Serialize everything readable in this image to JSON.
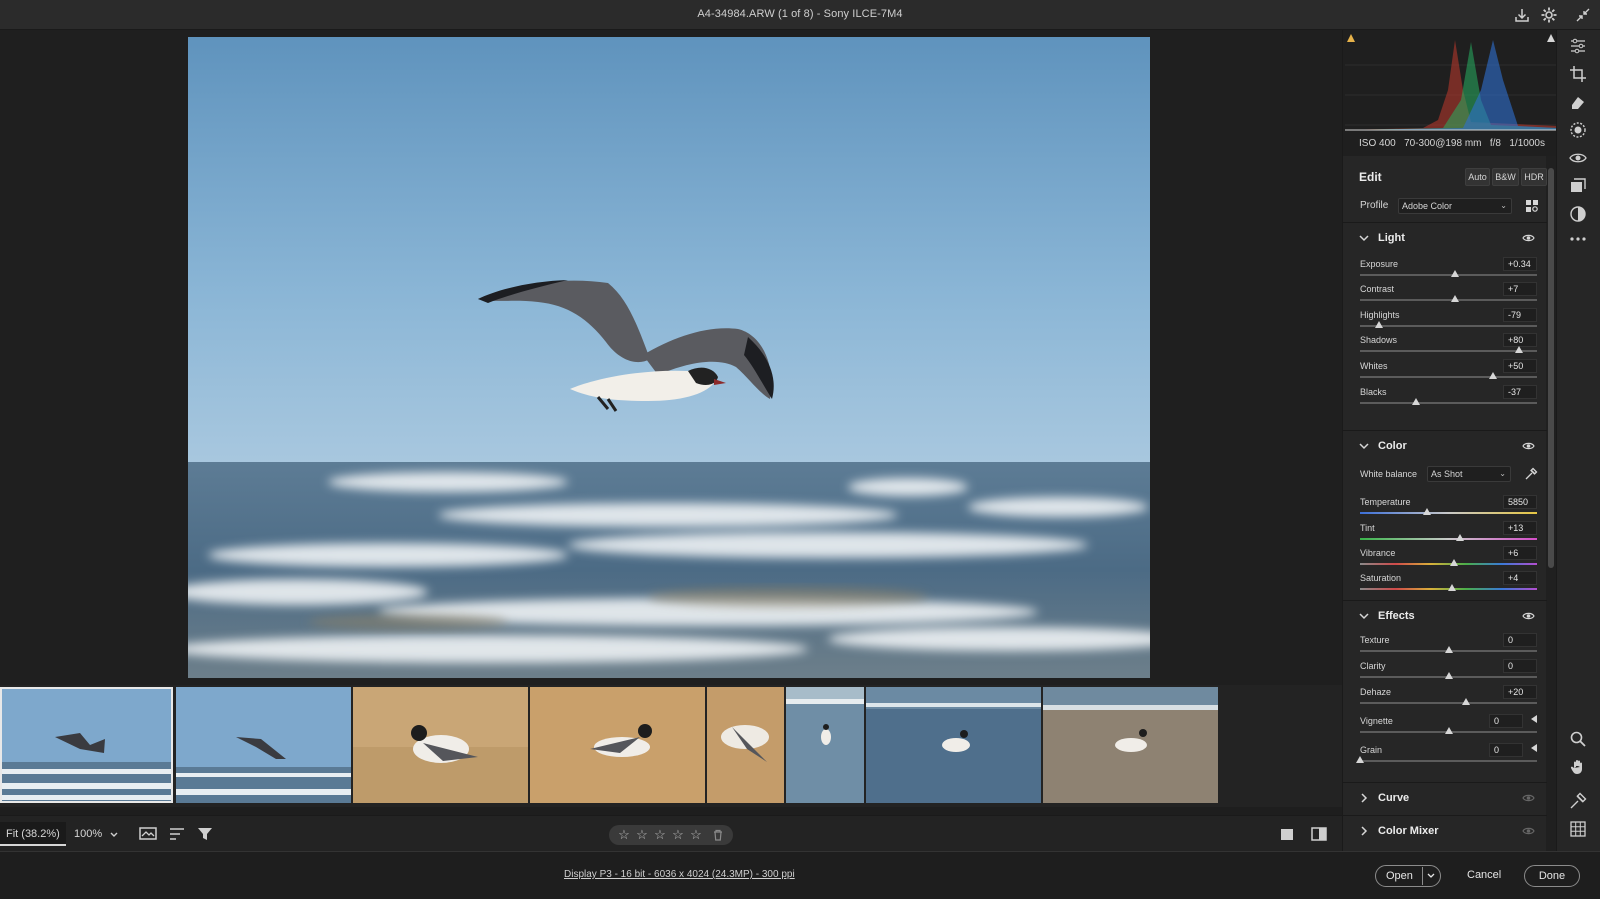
{
  "window": {
    "title": "A4-34984.ARW (1 of 8)  -  Sony ILCE-7M4"
  },
  "zoom": {
    "fit_label": "Fit (38.2%)",
    "percent_label": "100%"
  },
  "filmstrip": {
    "count": 8,
    "selected_index": 0
  },
  "rating": {
    "stars": [
      "☆",
      "☆",
      "☆",
      "☆",
      "☆"
    ]
  },
  "footer": {
    "info": "Display P3 - 16 bit - 6036 x 4024 (24.3MP) - 300 ppi",
    "open_label": "Open",
    "cancel_label": "Cancel",
    "done_label": "Done"
  },
  "exif": {
    "iso": "ISO 400",
    "lens": "70-300@198 mm",
    "aperture": "f/8",
    "shutter": "1/1000s"
  },
  "edit": {
    "title": "Edit",
    "auto_label": "Auto",
    "bw_label": "B&W",
    "hdr_label": "HDR",
    "profile_label": "Profile",
    "profile_value": "Adobe Color"
  },
  "light": {
    "title": "Light",
    "sliders": [
      {
        "label": "Exposure",
        "value": "+0.34",
        "level": 0.534
      },
      {
        "label": "Contrast",
        "value": "+7",
        "level": 0.535
      },
      {
        "label": "Highlights",
        "value": "-79",
        "level": 0.105
      },
      {
        "label": "Shadows",
        "value": "+80",
        "level": 0.9
      },
      {
        "label": "Whites",
        "value": "+50",
        "level": 0.75
      },
      {
        "label": "Blacks",
        "value": "-37",
        "level": 0.315
      }
    ]
  },
  "color": {
    "title": "Color",
    "wb_label": "White balance",
    "wb_value": "As Shot",
    "sliders": [
      {
        "label": "Temperature",
        "value": "5850",
        "level": 0.38
      },
      {
        "label": "Tint",
        "value": "+13",
        "level": 0.565
      },
      {
        "label": "Vibrance",
        "value": "+6",
        "level": 0.53
      },
      {
        "label": "Saturation",
        "value": "+4",
        "level": 0.52
      }
    ]
  },
  "effects": {
    "title": "Effects",
    "sliders": [
      {
        "label": "Texture",
        "value": "0",
        "level": 0.5
      },
      {
        "label": "Clarity",
        "value": "0",
        "level": 0.5
      },
      {
        "label": "Dehaze",
        "value": "+20",
        "level": 0.6
      },
      {
        "label": "Vignette",
        "value": "0",
        "level": 0.5
      },
      {
        "label": "Grain",
        "value": "0",
        "level": 0.0
      }
    ]
  },
  "curve": {
    "title": "Curve"
  },
  "color_mixer": {
    "title": "Color Mixer"
  },
  "icons": {
    "titlebar": [
      "save-icon",
      "gear-icon",
      "collapse-icon"
    ],
    "toolbar": [
      "edit-sliders-icon",
      "crop-icon",
      "healing-icon",
      "mask-icon",
      "red-eye-icon",
      "presets-icon",
      "snapshots-icon",
      "more-icon",
      "zoom-icon",
      "hand-icon",
      "color-sampler-icon",
      "grid-icon"
    ]
  },
  "colors": {
    "accent": "#d6d6d6",
    "background": "#1e1e1e",
    "panel": "#262626"
  }
}
